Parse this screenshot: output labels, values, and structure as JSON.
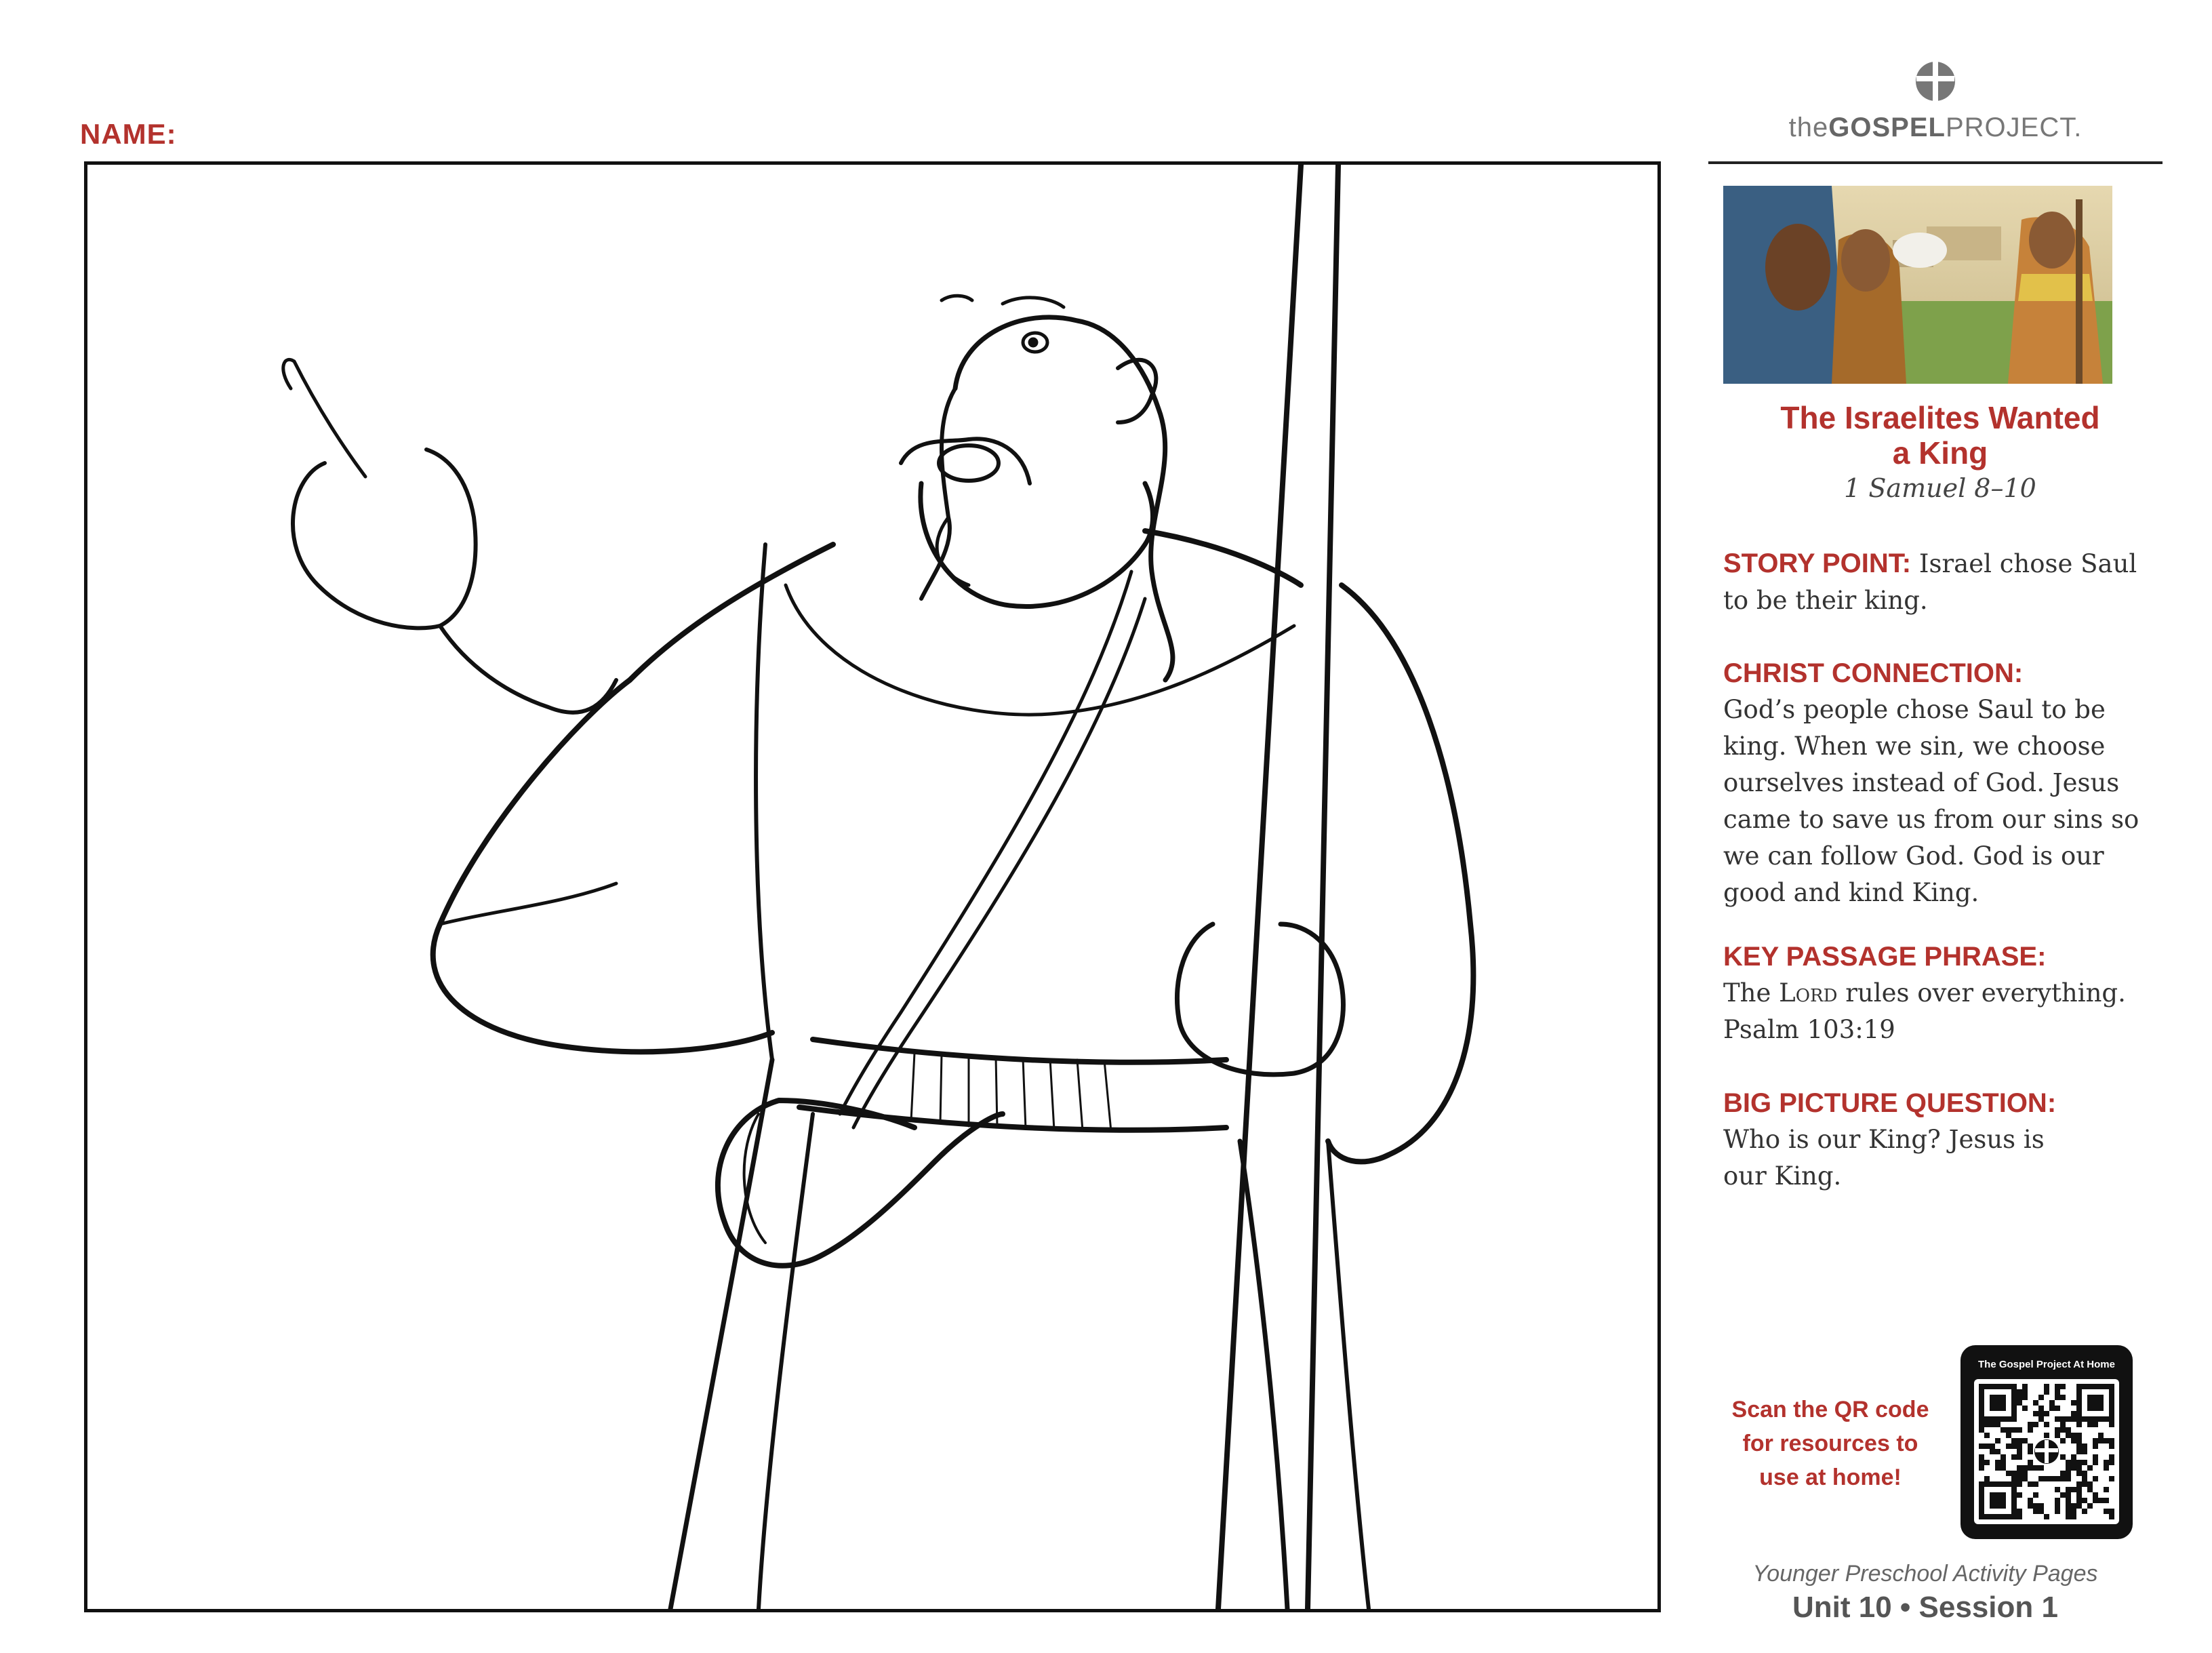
{
  "worksheet": {
    "name_label": "NAME:"
  },
  "logo": {
    "prefix": "the",
    "bold": "GOSPEL",
    "suffix": "PROJECT."
  },
  "lesson": {
    "title_line1": "The Israelites Wanted",
    "title_line2": "a King",
    "scripture": "1 Samuel 8–10"
  },
  "story_point": {
    "heading": "STORY POINT:",
    "text": "Israel chose Saul to be their king."
  },
  "christ_connection": {
    "heading": "CHRIST CONNECTION:",
    "text": "God’s people chose Saul to be king. When we sin, we choose ourselves instead of God. Jesus came to save us from our sins so we can follow God. God is our good and kind King."
  },
  "key_passage": {
    "heading": "KEY PASSAGE PHRASE:",
    "text_before": "The ",
    "lord": "Lord",
    "text_after": " rules over everything.",
    "reference": "Psalm 103:19"
  },
  "big_picture": {
    "heading": "BIG PICTURE QUESTION:",
    "text": "Who is our King? Jesus is our King."
  },
  "qr": {
    "prompt_line1": "Scan the QR code",
    "prompt_line2": "for resources to",
    "prompt_line3": "use at home!",
    "card_title": "The Gospel Project At Home"
  },
  "footer": {
    "subtitle": "Younger Preschool Activity Pages",
    "unit_session": "Unit 10 • Session 1"
  },
  "colors": {
    "accent": "#b3322d",
    "text": "#333333"
  },
  "icons": [
    "cross-circle-logo-icon",
    "qr-code-icon"
  ]
}
